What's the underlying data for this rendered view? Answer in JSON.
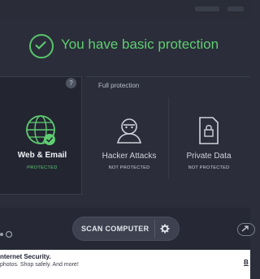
{
  "status": {
    "message": "You have basic protection",
    "icon": "check-circle-icon",
    "color": "#5fce72"
  },
  "panels": {
    "help_badge": "?",
    "full_protection_title": "Full protection",
    "web_email": {
      "label": "Web & Email",
      "status": "PROTECTED",
      "icon": "globe-check-icon"
    },
    "hacker_attacks": {
      "label": "Hacker Attacks",
      "status": "NOT PROTECTED",
      "icon": "hacker-icon"
    },
    "private_data": {
      "label": "Private Data",
      "status": "NOT PROTECTED",
      "icon": "lock-icon"
    }
  },
  "actions": {
    "scan_label": "SCAN COMPUTER",
    "settings_icon": "gear-icon"
  },
  "promo": {
    "title": "nternet Security.",
    "subtitle": "photos. Shop safely. And more!",
    "link": "B"
  },
  "colors": {
    "background": "#2b2e3a",
    "accent_green": "#5fce72",
    "button": "#3e4250"
  }
}
